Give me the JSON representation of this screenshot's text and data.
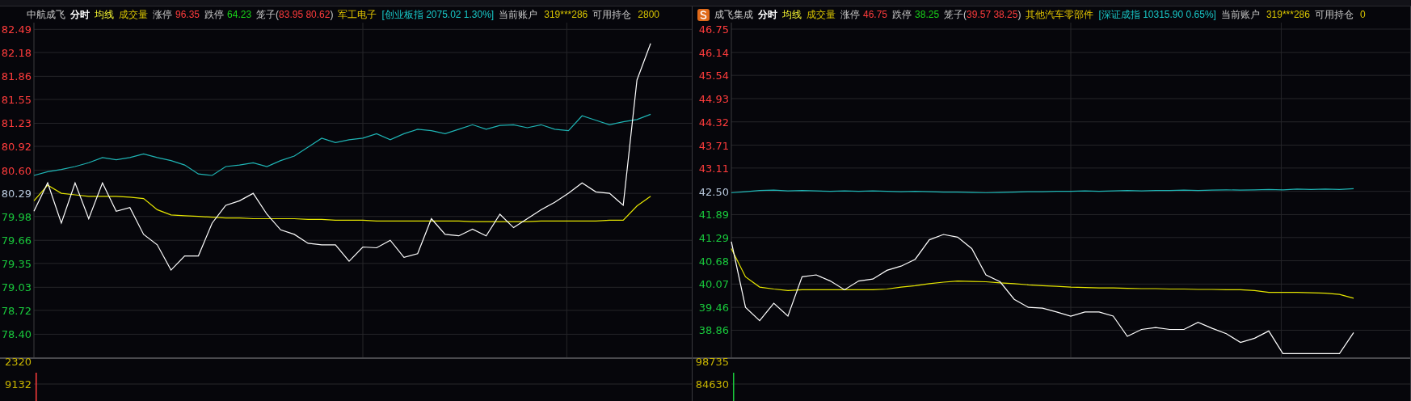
{
  "panels": [
    {
      "header": {
        "name": "中航成飞",
        "period": "分时",
        "avg_line": "均线",
        "volume": "成交量",
        "limit_up_label": "涨停",
        "limit_up": "96.35",
        "limit_down_label": "跌停",
        "limit_down": "64.23",
        "cage_label": "笼子(",
        "cage": "83.95 80.62",
        "cage_close": ")",
        "sector": "军工电子",
        "index": "[创业板指 2075.02 1.30%]",
        "account_label": "当前账户",
        "account": "319***286",
        "holding_label": "可用持仓",
        "holding": "2800"
      },
      "chart_data": {
        "type": "line",
        "ylim": [
          78.09,
          82.58
        ],
        "grid": true,
        "yticks": [
          {
            "value": 78.4,
            "label": "78.40"
          },
          {
            "value": 78.72,
            "label": "78.72"
          },
          {
            "value": 79.03,
            "label": "79.03"
          },
          {
            "value": 79.35,
            "label": "79.35"
          },
          {
            "value": 79.66,
            "label": "79.66"
          },
          {
            "value": 79.98,
            "label": "79.98"
          },
          {
            "value": 80.29,
            "label": "80.29"
          },
          {
            "value": 80.6,
            "label": "80.60"
          },
          {
            "value": 80.92,
            "label": "80.92"
          },
          {
            "value": 81.23,
            "label": "81.23"
          },
          {
            "value": 81.55,
            "label": "81.55"
          },
          {
            "value": 81.86,
            "label": "81.86"
          },
          {
            "value": 82.18,
            "label": "82.18"
          },
          {
            "value": 82.49,
            "label": "82.49"
          }
        ],
        "categories": [
          null,
          null,
          null,
          null,
          null,
          null,
          null,
          null,
          null,
          null,
          null,
          null,
          null,
          null,
          null,
          null,
          null,
          null,
          null,
          null,
          null,
          null,
          null,
          null,
          null,
          null,
          null,
          null,
          null,
          null,
          null,
          null,
          null,
          null,
          null,
          null,
          null,
          null,
          null,
          null,
          null,
          null,
          null,
          null,
          null,
          null
        ],
        "series": [
          {
            "color": "#ffffff",
            "values": [
              80.05,
              80.43,
              79.89,
              80.43,
              79.95,
              80.43,
              80.05,
              80.1,
              79.74,
              79.6,
              79.26,
              79.45,
              79.45,
              79.89,
              80.13,
              80.19,
              80.29,
              80.01,
              79.8,
              79.74,
              79.62,
              79.6,
              79.6,
              79.38,
              79.57,
              79.56,
              79.66,
              79.43,
              79.48,
              79.95,
              79.74,
              79.72,
              79.81,
              79.72,
              80.01,
              79.83,
              79.95,
              80.07,
              80.17,
              80.29,
              80.43,
              80.31,
              80.29,
              80.13,
              81.81,
              82.3
            ]
          },
          {
            "color": "#e6e600",
            "values": [
              80.19,
              80.4,
              80.29,
              80.27,
              80.25,
              80.25,
              80.25,
              80.24,
              80.22,
              80.07,
              80.0,
              79.99,
              79.98,
              79.97,
              79.96,
              79.96,
              79.95,
              79.95,
              79.95,
              79.95,
              79.94,
              79.94,
              79.93,
              79.93,
              79.93,
              79.92,
              79.92,
              79.92,
              79.92,
              79.92,
              79.92,
              79.92,
              79.91,
              79.91,
              79.91,
              79.91,
              79.91,
              79.92,
              79.92,
              79.92,
              79.92,
              79.92,
              79.93,
              79.93,
              80.12,
              80.25
            ]
          },
          {
            "color": "#1fb5b5",
            "values": [
              80.53,
              80.58,
              80.61,
              80.65,
              80.7,
              80.77,
              80.74,
              80.77,
              80.82,
              80.77,
              80.73,
              80.67,
              80.55,
              80.53,
              80.65,
              80.67,
              80.7,
              80.65,
              80.73,
              80.79,
              80.91,
              81.03,
              80.97,
              81.01,
              81.03,
              81.09,
              81.01,
              81.09,
              81.15,
              81.13,
              81.09,
              81.15,
              81.21,
              81.15,
              81.2,
              81.21,
              81.17,
              81.21,
              81.15,
              81.13,
              81.33,
              81.27,
              81.21,
              81.25,
              81.28,
              81.35
            ]
          }
        ]
      },
      "volume_axis": [
        "2320",
        "9132"
      ]
    },
    {
      "header": {
        "name": "成飞集成",
        "period": "分时",
        "avg_line": "均线",
        "volume": "成交量",
        "limit_up_label": "涨停",
        "limit_up": "46.75",
        "limit_down_label": "跌停",
        "limit_down": "38.25",
        "cage_label": "笼子(",
        "cage": "39.57 38.25",
        "cage_close": ")",
        "sector": "其他汽车零部件",
        "index": "[深证成指 10315.90 0.65%]",
        "account_label": "当前账户",
        "account": "319***286",
        "holding_label": "可用持仓",
        "holding": "0"
      },
      "chart_data": {
        "type": "line",
        "ylim": [
          38.15,
          46.92
        ],
        "grid": true,
        "yticks": [
          {
            "value": 38.86,
            "label": "38.86"
          },
          {
            "value": 39.46,
            "label": "39.46"
          },
          {
            "value": 40.07,
            "label": "40.07"
          },
          {
            "value": 40.68,
            "label": "40.68"
          },
          {
            "value": 41.29,
            "label": "41.29"
          },
          {
            "value": 41.89,
            "label": "41.89"
          },
          {
            "value": 42.5,
            "label": "42.50"
          },
          {
            "value": 43.11,
            "label": "43.11"
          },
          {
            "value": 43.71,
            "label": "43.71"
          },
          {
            "value": 44.32,
            "label": "44.32"
          },
          {
            "value": 44.93,
            "label": "44.93"
          },
          {
            "value": 45.54,
            "label": "45.54"
          },
          {
            "value": 46.14,
            "label": "46.14"
          },
          {
            "value": 46.75,
            "label": "46.75"
          }
        ],
        "categories": [
          null,
          null,
          null,
          null,
          null,
          null,
          null,
          null,
          null,
          null,
          null,
          null,
          null,
          null,
          null,
          null,
          null,
          null,
          null,
          null,
          null,
          null,
          null,
          null,
          null,
          null,
          null,
          null,
          null,
          null,
          null,
          null,
          null,
          null,
          null,
          null,
          null,
          null,
          null,
          null,
          null,
          null,
          null,
          null,
          null
        ],
        "series": [
          {
            "color": "#ffffff",
            "values": [
              41.18,
              39.46,
              39.11,
              39.57,
              39.23,
              40.26,
              40.31,
              40.15,
              39.92,
              40.15,
              40.2,
              40.43,
              40.54,
              40.72,
              41.23,
              41.37,
              41.3,
              41.0,
              40.31,
              40.13,
              39.67,
              39.46,
              39.44,
              39.34,
              39.23,
              39.34,
              39.34,
              39.23,
              38.7,
              38.88,
              38.93,
              38.88,
              38.88,
              39.07,
              38.91,
              38.77,
              38.54,
              38.65,
              38.84,
              38.25,
              38.25,
              38.25,
              38.25,
              38.25,
              38.8
            ]
          },
          {
            "color": "#e6e600",
            "values": [
              41.0,
              40.26,
              39.99,
              39.94,
              39.9,
              39.92,
              39.92,
              39.92,
              39.92,
              39.92,
              39.92,
              39.94,
              39.99,
              40.03,
              40.08,
              40.12,
              40.15,
              40.14,
              40.13,
              40.1,
              40.08,
              40.05,
              40.03,
              40.01,
              39.99,
              39.98,
              39.97,
              39.97,
              39.96,
              39.95,
              39.95,
              39.94,
              39.94,
              39.93,
              39.93,
              39.92,
              39.92,
              39.9,
              39.85,
              39.85,
              39.85,
              39.84,
              39.83,
              39.8,
              39.7
            ]
          },
          {
            "color": "#1fb5b5",
            "values": [
              42.46,
              42.49,
              42.52,
              42.53,
              42.51,
              42.52,
              42.51,
              42.5,
              42.51,
              42.5,
              42.51,
              42.5,
              42.49,
              42.5,
              42.49,
              42.48,
              42.48,
              42.47,
              42.46,
              42.47,
              42.48,
              42.49,
              42.49,
              42.5,
              42.5,
              42.51,
              42.5,
              42.51,
              42.52,
              42.51,
              42.52,
              42.52,
              42.53,
              42.52,
              42.53,
              42.54,
              42.53,
              42.54,
              42.55,
              42.54,
              42.56,
              42.55,
              42.56,
              42.55,
              42.57
            ]
          }
        ]
      },
      "volume_axis": [
        "98735",
        "84630"
      ]
    }
  ]
}
